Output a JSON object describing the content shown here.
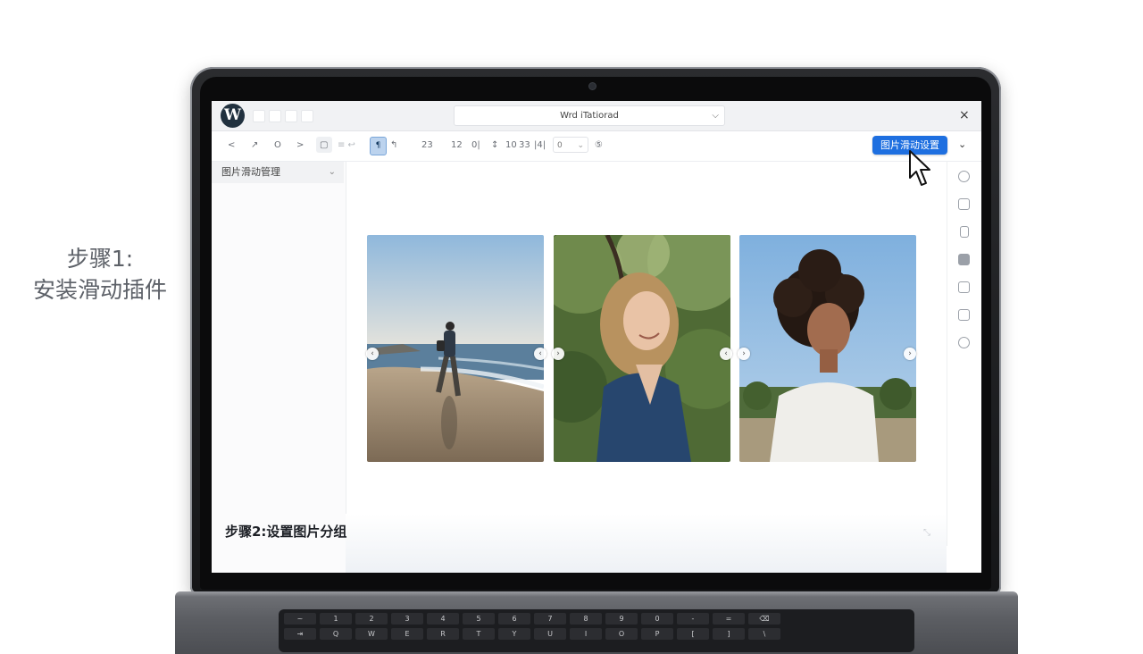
{
  "overlay": {
    "step1_line1": "步骤1:",
    "step1_line2": "安装滑动插件",
    "step2": "步骤2:设置图片分组"
  },
  "window": {
    "logo": "W",
    "document_title": "Wrd iTatiorad",
    "close_symbol": "×"
  },
  "toolbar": {
    "tools": [
      "<",
      "↗",
      "O",
      ">",
      "▢",
      "≡ ↩",
      "¶",
      "↰",
      "23",
      "12",
      "0|",
      "↕",
      "10",
      "33",
      "|4|",
      "⑤"
    ],
    "active_tool": "¶",
    "number_field_value": "0",
    "primary_button_label": "图片滑动设置"
  },
  "sidebar": {
    "panel_title": "图片滑动管理"
  },
  "right_rail": {
    "icons": [
      "comment-icon",
      "layers-icon",
      "page-icon",
      "block-icon",
      "device-icon",
      "lock-icon",
      "settings-icon"
    ]
  },
  "slider": {
    "slides": [
      {
        "name": "beach-walker-photo",
        "subject": "person walking on the beach"
      },
      {
        "name": "smiling-woman-photo",
        "subject": "smiling blonde woman under trees"
      },
      {
        "name": "curly-hair-photo",
        "subject": "person with curly hair, blue sky"
      }
    ],
    "prev_symbol": "‹",
    "next_symbol": "›"
  },
  "colors": {
    "primary": "#1e6fe0",
    "laptop": "#1c1d20",
    "sky": "#8fb8dc"
  },
  "keyboard": {
    "row_numbers": [
      "~",
      "1",
      "2",
      "3",
      "4",
      "5",
      "6",
      "7",
      "8",
      "9",
      "0",
      "-",
      "=",
      "⌫"
    ],
    "row_letters": [
      "⇥",
      "Q",
      "W",
      "E",
      "R",
      "T",
      "Y",
      "U",
      "I",
      "O",
      "P",
      "[",
      "]",
      "\\"
    ]
  }
}
